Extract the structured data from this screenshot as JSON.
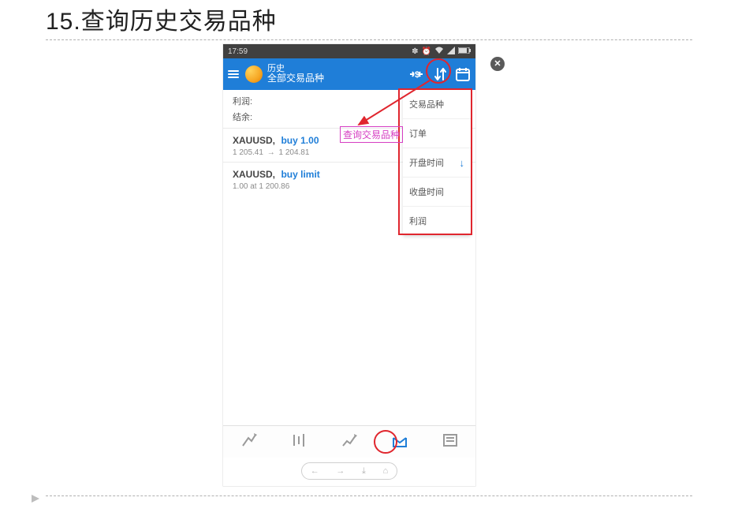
{
  "section": {
    "number": "15.",
    "title": "查询历史交易品种"
  },
  "statusbar": {
    "time": "17:59",
    "bt": "✽",
    "alarm": "⏰",
    "wifi": "▾",
    "batt": "▌▌"
  },
  "appbar": {
    "title_top": "历史",
    "title_sub": "全部交易品种"
  },
  "summary": {
    "profit_label": "利润:",
    "balance_label": "结余:"
  },
  "trades": [
    {
      "symbol": "XAUUSD,",
      "action": "buy 1.00",
      "from": "1 205.41",
      "to": "1 204.81"
    },
    {
      "symbol": "XAUUSD,",
      "action": "buy limit",
      "detail": "1.00 at 1 200.86"
    }
  ],
  "dropdown": {
    "items": [
      {
        "label": "交易品种",
        "arrow": false
      },
      {
        "label": "订单",
        "arrow": false
      },
      {
        "label": "开盘时间",
        "arrow": true
      },
      {
        "label": "收盘时间",
        "arrow": false
      },
      {
        "label": "利润",
        "arrow": false
      }
    ]
  },
  "annotation": {
    "label": "查询交易品种"
  },
  "close": {
    "glyph": "✕"
  },
  "tabs": {
    "quote": "quotes-tab",
    "chart": "chart-tab",
    "trade": "trade-tab",
    "history": "history-tab",
    "news": "news-tab"
  }
}
